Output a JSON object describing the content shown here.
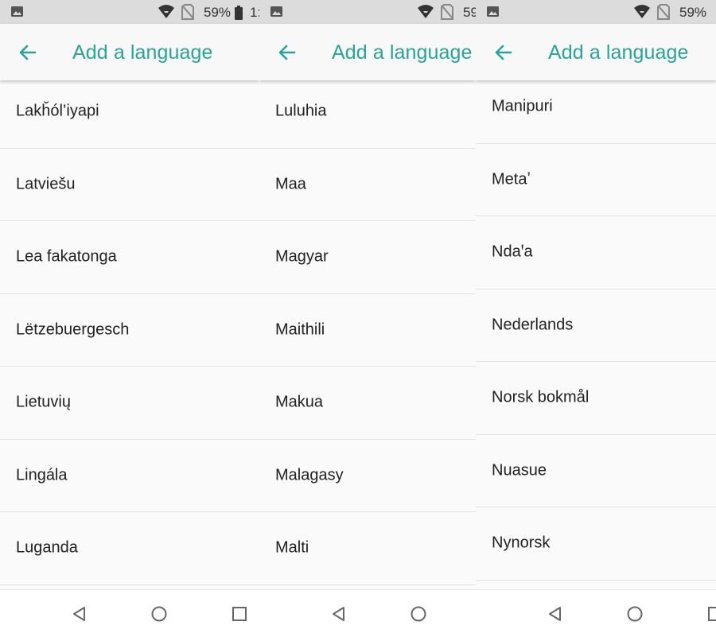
{
  "panels": [
    {
      "status": {
        "battery_text": "59%",
        "clock_text": "1:"
      },
      "title": "Add a language",
      "items": [
        "Lakȟól’iyapi",
        "Latviešu",
        "Lea fakatonga",
        "Lëtzebuergesch",
        "Lietuvių",
        "Lingála",
        "Luganda"
      ]
    },
    {
      "status": {
        "battery_text": "59",
        "clock_text": ""
      },
      "title": "Add a language",
      "items": [
        "Luluhia",
        "Maa",
        "Magyar",
        "Maithili",
        "Makua",
        "Malagasy",
        "Malti"
      ]
    },
    {
      "status": {
        "battery_text": "59%",
        "clock_text": ""
      },
      "title": "Add a language",
      "items": [
        "Manipuri",
        "Metaʼ",
        "Ndaꞌa",
        "Nederlands",
        "Norsk bokmål",
        "Nuasue",
        "Nynorsk"
      ]
    }
  ],
  "icons": {
    "back": "arrow-left-icon",
    "nav_back": "triangle-back-icon",
    "nav_home": "circle-home-icon",
    "nav_recents": "square-recents-icon"
  },
  "colors": {
    "accent": "#26a69a",
    "status_bar": "#dcdcdc",
    "background": "#fafafa",
    "divider": "#e1e1e1"
  }
}
